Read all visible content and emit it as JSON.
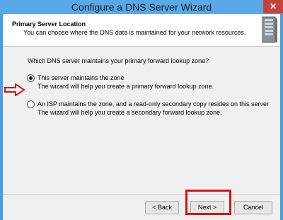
{
  "window": {
    "title": "Configure a DNS Server Wizard",
    "close_glyph": "✕"
  },
  "header": {
    "title": "Primary Server Location",
    "subtitle": "You can choose where the DNS data is maintained for your network resources.",
    "icon": "server-icon"
  },
  "main": {
    "question": "Which DNS server maintains your primary forward lookup zone?",
    "options": [
      {
        "label": "This server maintains the zone",
        "description": "The wizard will help you create a primary forward lookup zone.",
        "selected": true
      },
      {
        "label": "An ISP maintains the zone, and a read-only secondary copy resides on this server",
        "description": "The wizard will help you create a secondary forward lookup zone.",
        "selected": false
      }
    ]
  },
  "annotations": {
    "arrow_color": "#e01010",
    "highlight_color": "#e01010"
  },
  "footer": {
    "back_label": "< Back",
    "next_label": "Next >",
    "cancel_label": "Cancel"
  }
}
